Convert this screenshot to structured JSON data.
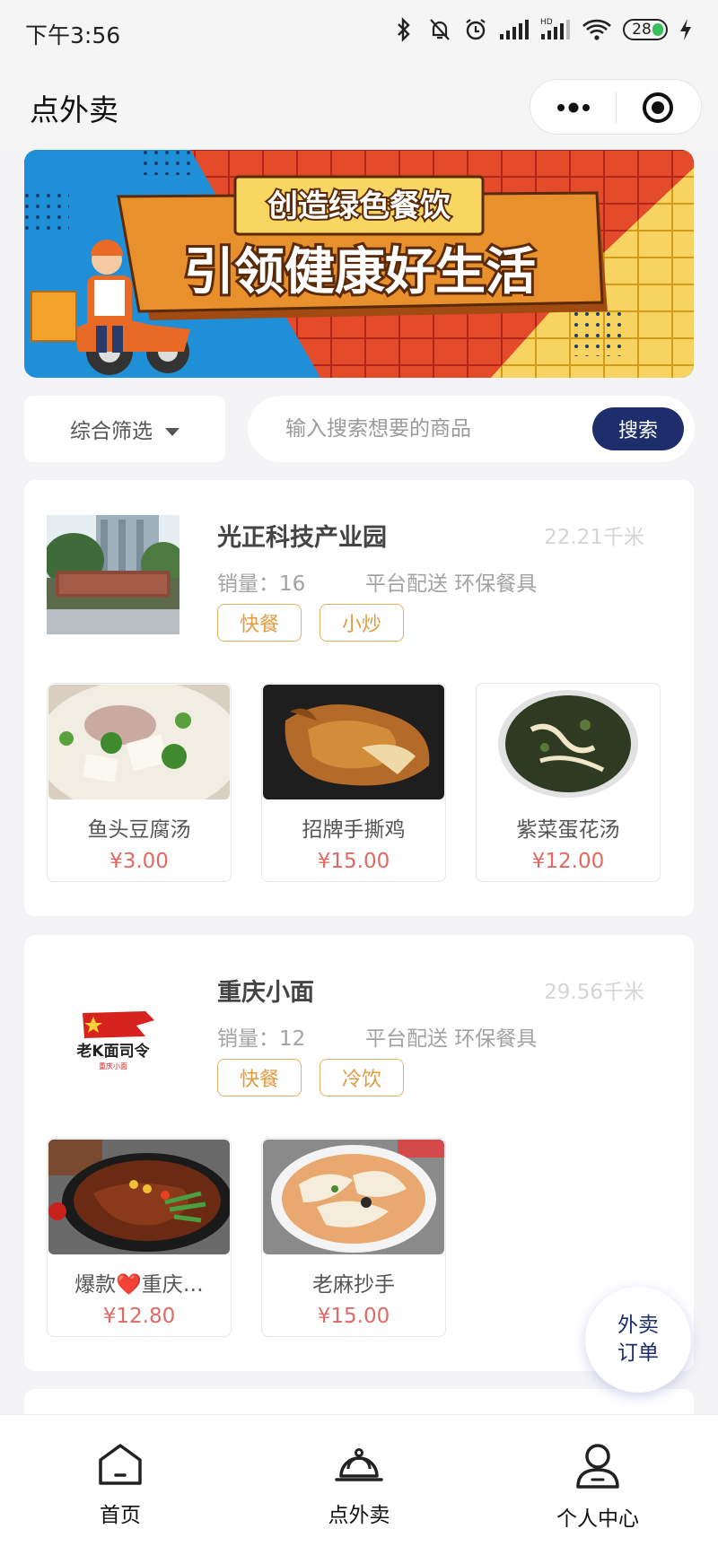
{
  "status_bar": {
    "time": "下午3:56",
    "battery": "28"
  },
  "header": {
    "title": "点外卖"
  },
  "banner": {
    "line1": "创造绿色餐饮",
    "line2": "引领健康好生活"
  },
  "filter": {
    "label": "综合筛选"
  },
  "search": {
    "placeholder": "输入搜索想要的商品",
    "button": "搜索"
  },
  "stores": [
    {
      "name": "光正科技产业园",
      "distance": "22.21千米",
      "sales": "销量：16",
      "service": "平台配送 环保餐具",
      "tags": [
        "快餐",
        "小炒"
      ],
      "dishes": [
        {
          "name": "鱼头豆腐汤",
          "price": "¥3.00"
        },
        {
          "name": "招牌手撕鸡",
          "price": "¥15.00"
        },
        {
          "name": "紫菜蛋花汤",
          "price": "¥12.00"
        }
      ]
    },
    {
      "name": "重庆小面",
      "distance": "29.56千米",
      "sales": "销量：12",
      "service": "平台配送 环保餐具",
      "tags": [
        "快餐",
        "冷饮"
      ],
      "logo_text": "老K面司令",
      "logo_sub": "重庆小面",
      "dishes": [
        {
          "name": "爆款❤️重庆…",
          "price": "¥12.80"
        },
        {
          "name": "老麻抄手",
          "price": "¥15.00"
        }
      ]
    }
  ],
  "fab": {
    "line1": "外卖",
    "line2": "订单"
  },
  "tabbar": {
    "items": [
      {
        "label": "首页",
        "icon": "home-icon"
      },
      {
        "label": "点外卖",
        "icon": "cloche-icon"
      },
      {
        "label": "个人中心",
        "icon": "user-icon"
      }
    ]
  },
  "colors": {
    "primary": "#1e2d6b",
    "price": "#e06a64",
    "tag": "#e29a3d",
    "banner_blue": "#1f8fd8",
    "banner_orange": "#e8902b",
    "banner_red": "#e34b2a",
    "banner_yellow": "#f7d461"
  }
}
